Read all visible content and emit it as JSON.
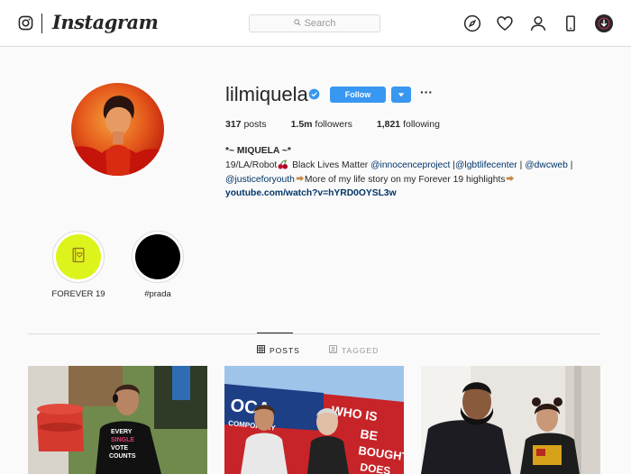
{
  "nav": {
    "brand": "Instagram",
    "search_placeholder": "Search",
    "icons": [
      "instagram-glyph-icon",
      "search-icon",
      "compass-icon",
      "heart-icon",
      "person-icon",
      "phone-icon",
      "download-icon"
    ]
  },
  "profile": {
    "username": "lilmiquela",
    "verified": true,
    "follow_label": "Follow",
    "stats": {
      "posts_count": "317",
      "posts_label": "posts",
      "followers_count": "1.5m",
      "followers_label": "followers",
      "following_count": "1,821",
      "following_label": "following"
    },
    "bio": {
      "name": "*~ MIQUELA ~*",
      "line1_a": "19/LA/Robot",
      "line1_b": " Black Lives Matter ",
      "mention1": "@innocenceproject",
      "sep1": " |",
      "mention2": "@lgbtlifecenter",
      "sep2": " | ",
      "mention3": "@dwcweb",
      "sep3": " |",
      "mention4": "@justiceforyouth",
      "line2": "More of my life story on my Forever 19 highlights",
      "link": "youtube.com/watch?v=hYRD0OYSL3w"
    }
  },
  "highlights": [
    {
      "label": "FOREVER 19",
      "color": "#dcf41b"
    },
    {
      "label": "#prada",
      "color": "#000000"
    }
  ],
  "tabs": {
    "posts_label": "POSTS",
    "tagged_label": "TAGGED",
    "active": "POSTS"
  },
  "posts": [
    {
      "alt_text": "EVERY SINGLE VOTE COUNTS"
    },
    {
      "alt_text": "OCA COMPORARY WHO IS BE BOUGHT DOES"
    },
    {
      "alt_text": ""
    }
  ],
  "colors": {
    "accent": "#3897f0",
    "link": "#003569",
    "border": "#dbdbdb",
    "background": "#fafafa"
  }
}
